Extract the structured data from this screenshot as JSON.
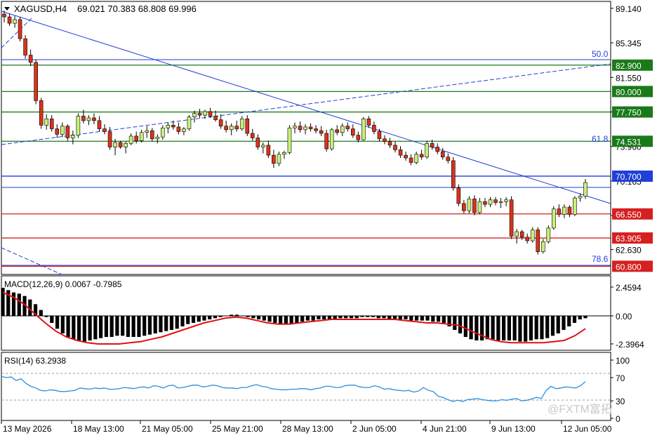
{
  "header": {
    "symbol": "XAGUSD,H4",
    "ohlc": "69.021 70.383 68.808 69.996"
  },
  "price_axis": {
    "ticks": [
      "89.140",
      "85.345",
      "81.550",
      "77.755",
      "73.960",
      "70.165",
      "66.370",
      "62.630"
    ]
  },
  "horizontal_levels": [
    {
      "price": 82.9,
      "label": "82.900",
      "color": "#1a7a1a"
    },
    {
      "price": 80.0,
      "label": "80.000",
      "color": "#1a7a1a"
    },
    {
      "price": 77.75,
      "label": "77.750",
      "color": "#1a7a1a"
    },
    {
      "price": 74.531,
      "label": "74.531",
      "color": "#1a7a1a"
    },
    {
      "price": 70.7,
      "label": "70.700",
      "color": "#1f3fd6"
    },
    {
      "price": 66.55,
      "label": "66.550",
      "color": "#d62020"
    },
    {
      "price": 63.905,
      "label": "63.905",
      "color": "#d62020"
    },
    {
      "price": 60.8,
      "label": "60.800",
      "color": "#d62020"
    }
  ],
  "fib_labels": [
    "50.0",
    "61.8",
    "78.6"
  ],
  "macd": {
    "label": "MACD(12,26,9) 0.0067 -0.7985",
    "ticks": [
      "2.4594",
      "0.00",
      "-2.3964"
    ],
    "histogram": [
      2.4,
      2.2,
      2.0,
      1.9,
      1.7,
      1.4,
      1.0,
      0.5,
      -0.1,
      -0.6,
      -1.1,
      -1.5,
      -1.8,
      -2.0,
      -2.1,
      -2.2,
      -2.1,
      -2.0,
      -1.9,
      -1.8,
      -1.8,
      -1.7,
      -1.7,
      -1.8,
      -1.8,
      -1.8,
      -1.7,
      -1.6,
      -1.5,
      -1.4,
      -1.3,
      -1.2,
      -1.1,
      -0.9,
      -0.7,
      -0.6,
      -0.5,
      -0.4,
      -0.3,
      -0.2,
      -0.1,
      0.0,
      0.1,
      0.1,
      0.0,
      -0.1,
      -0.2,
      -0.3,
      -0.4,
      -0.5,
      -0.6,
      -0.7,
      -0.7,
      -0.7,
      -0.6,
      -0.5,
      -0.4,
      -0.4,
      -0.3,
      -0.3,
      -0.3,
      -0.3,
      -0.2,
      -0.2,
      -0.2,
      -0.2,
      -0.1,
      -0.1,
      -0.1,
      -0.2,
      -0.2,
      -0.3,
      -0.3,
      -0.3,
      -0.3,
      -0.4,
      -0.4,
      -0.4,
      -0.4,
      -0.5,
      -0.5,
      -0.6,
      -0.9,
      -1.2,
      -1.5,
      -1.8,
      -2.0,
      -2.1,
      -2.1,
      -2.0,
      -2.0,
      -2.1,
      -2.1,
      -2.1,
      -2.1,
      -2.2,
      -2.2,
      -2.1,
      -2.0,
      -2.0,
      -1.9,
      -1.7,
      -1.5,
      -1.2,
      -0.9,
      -0.6,
      -0.3,
      -0.2
    ],
    "signal": [
      2.0,
      1.6,
      1.0,
      0.2,
      -0.6,
      -1.3,
      -1.8,
      -2.1,
      -2.3,
      -2.4,
      -2.4,
      -2.4,
      -2.3,
      -2.2,
      -2.0,
      -1.8,
      -1.5,
      -1.2,
      -0.9,
      -0.6,
      -0.4,
      -0.2,
      -0.1,
      -0.2,
      -0.4,
      -0.6,
      -0.7,
      -0.7,
      -0.6,
      -0.5,
      -0.4,
      -0.3,
      -0.3,
      -0.3,
      -0.3,
      -0.3,
      -0.3,
      -0.3,
      -0.4,
      -0.5,
      -0.6,
      -0.6,
      -0.7,
      -0.8,
      -1.2,
      -1.6,
      -2.0,
      -2.2,
      -2.3,
      -2.3,
      -2.3,
      -2.3,
      -2.2,
      -2.1,
      -1.7,
      -1.1
    ]
  },
  "rsi": {
    "label": "RSI(14) 63.2938",
    "ticks": [
      "100",
      "70",
      "30",
      "0"
    ],
    "values": [
      72,
      70,
      71,
      65,
      68,
      60,
      55,
      52,
      48,
      47,
      49,
      48,
      46,
      46,
      47,
      48,
      52,
      51,
      50,
      52,
      51,
      52,
      50,
      50,
      51,
      53,
      52,
      51,
      53,
      54,
      52,
      56,
      55,
      52,
      56,
      57,
      52,
      53,
      55,
      57,
      57,
      54,
      55,
      57,
      56,
      53,
      52,
      52,
      51,
      53,
      53,
      56,
      58,
      55,
      54,
      51,
      50,
      49,
      49,
      50,
      50,
      51,
      51,
      49,
      51,
      52,
      55,
      55,
      53,
      53,
      56,
      57,
      57,
      54,
      53,
      53,
      56,
      54,
      50,
      51,
      49,
      48,
      47,
      48,
      45,
      47,
      53,
      48,
      46,
      38,
      36,
      32,
      29,
      31,
      29,
      32,
      33,
      34,
      32,
      31,
      30,
      30,
      32,
      31,
      33,
      34,
      30,
      31,
      33,
      36,
      34,
      48,
      55,
      51,
      52,
      54,
      53,
      52,
      56,
      63
    ]
  },
  "time_axis": [
    "13 May 2026",
    "18 May 13:00",
    "21 May 05:00",
    "25 May 21:00",
    "28 May 13:00",
    "2 Jun 05:00",
    "4 Jun 21:00",
    "9 Jun 13:00",
    "12 Jun 05:00"
  ],
  "watermark": "@FXTM富拓",
  "chart_data": {
    "type": "candlestick",
    "price_range": [
      59.9,
      89.9
    ],
    "series": [
      {
        "candles_ohlc": [
          [
            88.5,
            88.9,
            87.6,
            88.2
          ],
          [
            88.2,
            88.6,
            87.2,
            87.5
          ],
          [
            87.5,
            88.3,
            87.0,
            87.9
          ],
          [
            87.9,
            88.2,
            85.5,
            85.8
          ],
          [
            85.8,
            86.2,
            83.6,
            84.0
          ],
          [
            84.0,
            84.6,
            82.8,
            83.2
          ],
          [
            83.2,
            83.5,
            78.6,
            79.0
          ],
          [
            79.0,
            79.3,
            75.9,
            76.3
          ],
          [
            76.3,
            77.5,
            75.8,
            77.0
          ],
          [
            77.0,
            77.4,
            75.6,
            75.9
          ],
          [
            75.9,
            76.4,
            74.9,
            75.3
          ],
          [
            75.3,
            76.6,
            75.0,
            76.2
          ],
          [
            76.2,
            76.4,
            74.6,
            74.9
          ],
          [
            74.9,
            75.7,
            74.2,
            75.2
          ],
          [
            75.2,
            77.6,
            74.9,
            77.3
          ],
          [
            77.3,
            78.0,
            76.5,
            76.8
          ],
          [
            76.8,
            77.4,
            76.3,
            77.1
          ],
          [
            77.1,
            77.6,
            76.4,
            76.8
          ],
          [
            76.8,
            77.3,
            75.6,
            75.9
          ],
          [
            75.9,
            76.4,
            75.3,
            75.6
          ],
          [
            75.6,
            76.1,
            73.6,
            73.9
          ],
          [
            73.9,
            74.8,
            73.0,
            74.4
          ],
          [
            74.4,
            74.6,
            73.7,
            73.9
          ],
          [
            73.9,
            74.5,
            73.2,
            74.3
          ],
          [
            74.3,
            75.4,
            74.1,
            75.1
          ],
          [
            75.1,
            75.6,
            74.3,
            74.6
          ],
          [
            74.6,
            75.8,
            74.4,
            75.5
          ],
          [
            75.5,
            76.2,
            74.9,
            75.7
          ],
          [
            75.7,
            76.0,
            74.5,
            74.8
          ],
          [
            74.8,
            75.3,
            74.3,
            75.0
          ],
          [
            75.0,
            76.3,
            74.7,
            76.0
          ],
          [
            76.0,
            76.6,
            75.4,
            76.3
          ],
          [
            76.3,
            76.8,
            75.8,
            76.1
          ],
          [
            76.1,
            76.6,
            75.3,
            75.6
          ],
          [
            75.6,
            76.1,
            75.2,
            75.9
          ],
          [
            75.9,
            77.4,
            75.7,
            77.2
          ],
          [
            77.2,
            77.9,
            76.6,
            77.6
          ],
          [
            77.6,
            78.1,
            77.1,
            77.4
          ],
          [
            77.4,
            78.0,
            77.0,
            77.8
          ],
          [
            77.8,
            78.2,
            77.1,
            77.3
          ],
          [
            77.3,
            77.9,
            76.7,
            76.9
          ],
          [
            76.9,
            77.5,
            75.9,
            76.2
          ],
          [
            76.2,
            76.8,
            75.5,
            75.8
          ],
          [
            75.8,
            76.5,
            75.2,
            76.2
          ],
          [
            76.2,
            76.8,
            75.6,
            75.9
          ],
          [
            75.9,
            77.3,
            75.7,
            77.0
          ],
          [
            77.0,
            77.4,
            75.1,
            75.4
          ],
          [
            75.4,
            75.9,
            74.6,
            74.9
          ],
          [
            74.9,
            75.3,
            73.6,
            73.9
          ],
          [
            73.9,
            74.4,
            73.2,
            74.1
          ],
          [
            74.1,
            74.6,
            72.7,
            73.0
          ],
          [
            73.0,
            73.6,
            71.6,
            72.1
          ],
          [
            72.1,
            73.4,
            71.8,
            73.1
          ],
          [
            73.1,
            73.5,
            72.6,
            73.3
          ],
          [
            73.3,
            76.3,
            73.1,
            76.0
          ],
          [
            76.0,
            76.6,
            75.4,
            76.2
          ],
          [
            76.2,
            76.7,
            75.5,
            75.8
          ],
          [
            75.8,
            76.4,
            75.3,
            76.1
          ],
          [
            76.1,
            76.5,
            75.6,
            75.9
          ],
          [
            75.9,
            76.3,
            75.4,
            75.7
          ],
          [
            75.7,
            76.2,
            75.1,
            75.4
          ],
          [
            75.4,
            75.8,
            73.4,
            73.7
          ],
          [
            73.7,
            76.0,
            73.5,
            75.8
          ],
          [
            75.8,
            76.3,
            75.2,
            75.5
          ],
          [
            75.5,
            76.5,
            75.1,
            76.2
          ],
          [
            76.2,
            76.6,
            75.6,
            75.9
          ],
          [
            75.9,
            76.4,
            74.9,
            75.2
          ],
          [
            75.2,
            75.6,
            74.4,
            74.7
          ],
          [
            74.7,
            77.2,
            74.6,
            77.0
          ],
          [
            77.0,
            77.3,
            76.0,
            76.3
          ],
          [
            76.3,
            76.7,
            75.3,
            75.6
          ],
          [
            75.6,
            75.9,
            74.5,
            74.8
          ],
          [
            74.8,
            75.2,
            74.2,
            74.5
          ],
          [
            74.5,
            74.9,
            73.8,
            74.1
          ],
          [
            74.1,
            74.5,
            73.3,
            73.6
          ],
          [
            73.6,
            74.0,
            72.7,
            73.0
          ],
          [
            73.0,
            73.4,
            72.4,
            72.7
          ],
          [
            72.7,
            73.1,
            71.9,
            72.2
          ],
          [
            72.2,
            73.4,
            72.0,
            73.1
          ],
          [
            73.1,
            73.6,
            72.5,
            72.8
          ],
          [
            72.8,
            74.6,
            72.6,
            74.3
          ],
          [
            74.3,
            74.7,
            73.6,
            73.9
          ],
          [
            73.9,
            74.3,
            73.1,
            73.4
          ],
          [
            73.4,
            73.8,
            72.5,
            72.8
          ],
          [
            72.8,
            73.2,
            72.1,
            72.4
          ],
          [
            72.4,
            72.8,
            69.1,
            69.4
          ],
          [
            69.4,
            69.8,
            67.4,
            67.7
          ],
          [
            67.7,
            68.1,
            66.6,
            66.9
          ],
          [
            66.9,
            68.5,
            66.6,
            68.2
          ],
          [
            68.2,
            68.6,
            66.4,
            66.7
          ],
          [
            66.7,
            68.3,
            66.5,
            67.9
          ],
          [
            67.9,
            68.3,
            67.3,
            67.6
          ],
          [
            67.6,
            68.4,
            67.3,
            68.1
          ],
          [
            68.1,
            68.4,
            67.5,
            67.8
          ],
          [
            67.8,
            68.3,
            67.2,
            67.9
          ],
          [
            67.9,
            68.4,
            67.4,
            68.1
          ],
          [
            68.1,
            68.5,
            63.8,
            64.1
          ],
          [
            64.1,
            64.9,
            63.3,
            64.6
          ],
          [
            64.6,
            64.8,
            63.7,
            64.0
          ],
          [
            64.0,
            64.4,
            63.3,
            63.6
          ],
          [
            63.6,
            65.1,
            63.4,
            64.8
          ],
          [
            64.8,
            65.1,
            62.1,
            62.4
          ],
          [
            62.4,
            63.8,
            62.2,
            63.5
          ],
          [
            63.5,
            65.3,
            63.3,
            65.0
          ],
          [
            65.0,
            67.4,
            64.8,
            67.1
          ],
          [
            67.1,
            67.6,
            66.2,
            66.5
          ],
          [
            66.5,
            67.6,
            66.1,
            67.3
          ],
          [
            67.3,
            67.5,
            66.2,
            66.5
          ],
          [
            66.5,
            68.5,
            66.3,
            68.3
          ],
          [
            68.3,
            68.8,
            67.9,
            68.5
          ],
          [
            68.5,
            70.383,
            68.2,
            69.996
          ]
        ]
      }
    ]
  }
}
